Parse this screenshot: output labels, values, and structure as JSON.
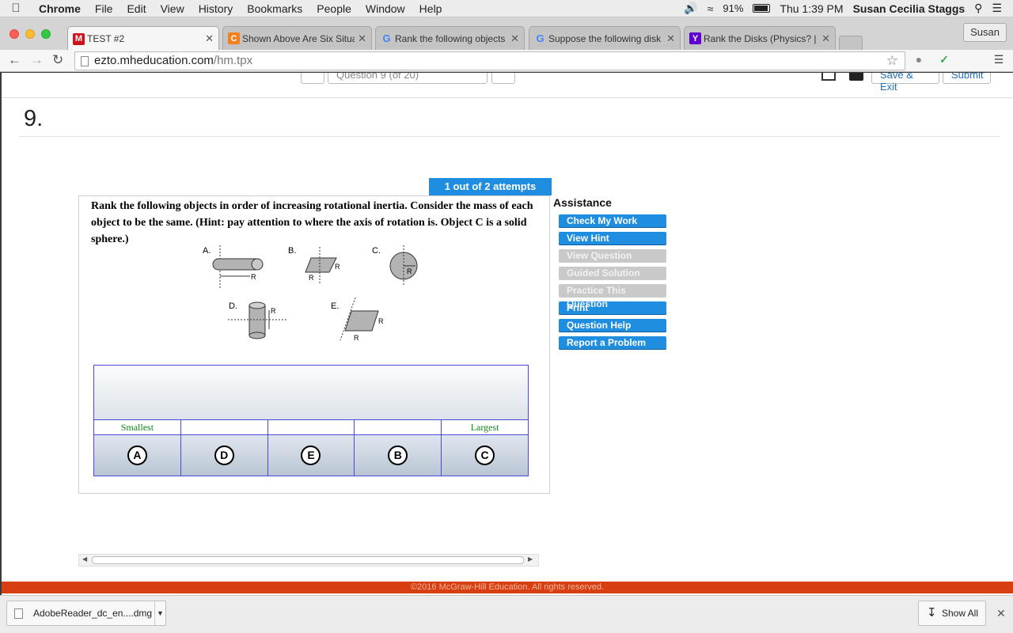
{
  "menubar": {
    "items": [
      "Chrome",
      "File",
      "Edit",
      "View",
      "History",
      "Bookmarks",
      "People",
      "Window",
      "Help"
    ],
    "battery": "91%",
    "clock": "Thu 1:39 PM",
    "user": "Susan Cecilia Staggs"
  },
  "tabs": [
    {
      "favicon": "M",
      "title": "TEST #2",
      "favicon_color": "#d0121b"
    },
    {
      "favicon": "C",
      "title": "Shown Above Are Six Situa",
      "favicon_color": "#f4801f"
    },
    {
      "favicon": "G",
      "title": "Rank the following objects",
      "favicon_color": "#4285f4"
    },
    {
      "favicon": "G",
      "title": "Suppose the following disk",
      "favicon_color": "#4285f4"
    },
    {
      "favicon": "Y",
      "title": "Rank the Disks (Physics? |",
      "favicon_color": "#5f01d1"
    }
  ],
  "profile_button": "Susan",
  "address": {
    "domain": "ezto.mheducation.com",
    "path": "/hm.tpx"
  },
  "top_nav": {
    "question_select": "Question 9 (of 20)",
    "save_exit": "Save & Exit",
    "submit": "Submit"
  },
  "question": {
    "number": "9.",
    "attempts": "1 out of 2 attempts",
    "text": "Rank the following objects in order of increasing rotational inertia. Consider the mass of each object to be the same. (Hint: pay attention to where the axis of rotation is. Object C is a solid sphere.)"
  },
  "figure": {
    "labels": [
      "A.",
      "B.",
      "C.",
      "D.",
      "E."
    ],
    "radius_label": "R"
  },
  "ranking": {
    "labels": [
      "Smallest",
      "",
      "",
      "",
      "Largest"
    ],
    "items": [
      "A",
      "D",
      "E",
      "B",
      "C"
    ]
  },
  "assistance": {
    "title": "Assistance",
    "buttons": [
      {
        "label": "Check My Work",
        "enabled": true
      },
      {
        "label": "View Hint",
        "enabled": true
      },
      {
        "label": "View Question",
        "enabled": false
      },
      {
        "label": "Guided Solution",
        "enabled": false
      },
      {
        "label": "Practice This Question",
        "enabled": false
      },
      {
        "label": "Print",
        "enabled": true
      },
      {
        "label": "Question Help",
        "enabled": true
      },
      {
        "label": "Report a Problem",
        "enabled": true
      }
    ]
  },
  "footer": "©2016 McGraw-Hill Education. All rights reserved.",
  "downloads": {
    "file": "AdobeReader_dc_en....dmg",
    "show_all": "Show All"
  },
  "colors": {
    "accent": "#1f8de0",
    "footer": "#d73f12",
    "rank_border": "#4a4ad8",
    "rank_label": "#118811"
  }
}
